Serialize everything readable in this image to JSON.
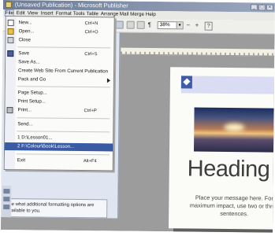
{
  "window": {
    "title": "(Unsaved Publication) - Microsoft Publisher"
  },
  "menubar": {
    "items": [
      "File",
      "Edit",
      "View",
      "Insert",
      "Format",
      "Tools",
      "Table",
      "Arrange",
      "Mail Merge",
      "Help"
    ]
  },
  "toolbar": {
    "zoom": "38%",
    "zoom_out": "−",
    "zoom_in": "+",
    "help": "?",
    "pilcrow": "¶"
  },
  "file_menu": {
    "items": [
      {
        "label": "New...",
        "shortcut": "Ctrl+N",
        "icon": "new-document-icon"
      },
      {
        "label": "Open...",
        "shortcut": "Ctrl+O",
        "icon": "open-folder-icon"
      },
      {
        "label": "Close",
        "shortcut": "",
        "icon": "close-document-icon"
      },
      {
        "label": "Save",
        "shortcut": "Ctrl+S",
        "icon": "save-disk-icon"
      },
      {
        "label": "Save As...",
        "shortcut": "",
        "icon": ""
      },
      {
        "label": "Create Web Site From Current Publication",
        "shortcut": "",
        "icon": ""
      },
      {
        "label": "Pack and Go",
        "shortcut": "",
        "icon": ""
      },
      {
        "label": "Page Setup...",
        "shortcut": "",
        "icon": ""
      },
      {
        "label": "Print Setup...",
        "shortcut": "",
        "icon": ""
      },
      {
        "label": "Print...",
        "shortcut": "Ctrl+P",
        "icon": "printer-icon"
      },
      {
        "label": "Send...",
        "shortcut": "",
        "icon": ""
      },
      {
        "label": "1 D:\\Lesson01...",
        "shortcut": "",
        "icon": ""
      },
      {
        "label": "2 F:\\Colour\\Book\\Lesson...",
        "shortcut": "",
        "icon": ""
      },
      {
        "label": "Exit",
        "shortcut": "Alt+F4",
        "icon": ""
      }
    ]
  },
  "task_pane": {
    "hint": "see what additional formatting options are available to you."
  },
  "document": {
    "heading": "Heading",
    "message": "Place your message here. For maximum impact, use two or three sentences."
  },
  "colors": {
    "title_bar": "#6d7c98",
    "menu_highlight": "#3a5aa3",
    "accent_band": "#d9dcf2",
    "page_corner": "#3f5aa8"
  }
}
